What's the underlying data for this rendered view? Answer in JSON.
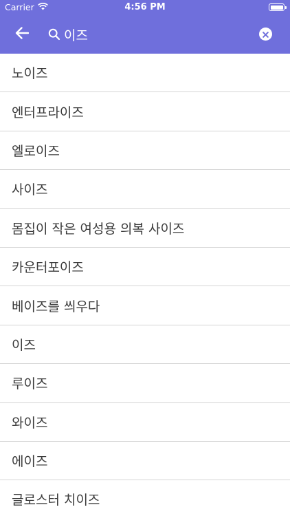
{
  "status_bar": {
    "carrier": "Carrier",
    "time": "4:56 PM"
  },
  "toolbar": {
    "back_icon": "arrow-left-icon",
    "search_icon": "magnifier-icon",
    "search_value": "이즈",
    "clear_icon": "clear-circle-icon",
    "background_color": "#6f6fdc"
  },
  "results": [
    "노이즈",
    "엔터프라이즈",
    "엘로이즈",
    "사이즈",
    "몸집이 작은 여성용 의복 사이즈",
    "카운터포이즈",
    "베이즈를 씌우다",
    "이즈",
    "루이즈",
    "와이즈",
    "에이즈",
    "글로스터 치이즈"
  ]
}
